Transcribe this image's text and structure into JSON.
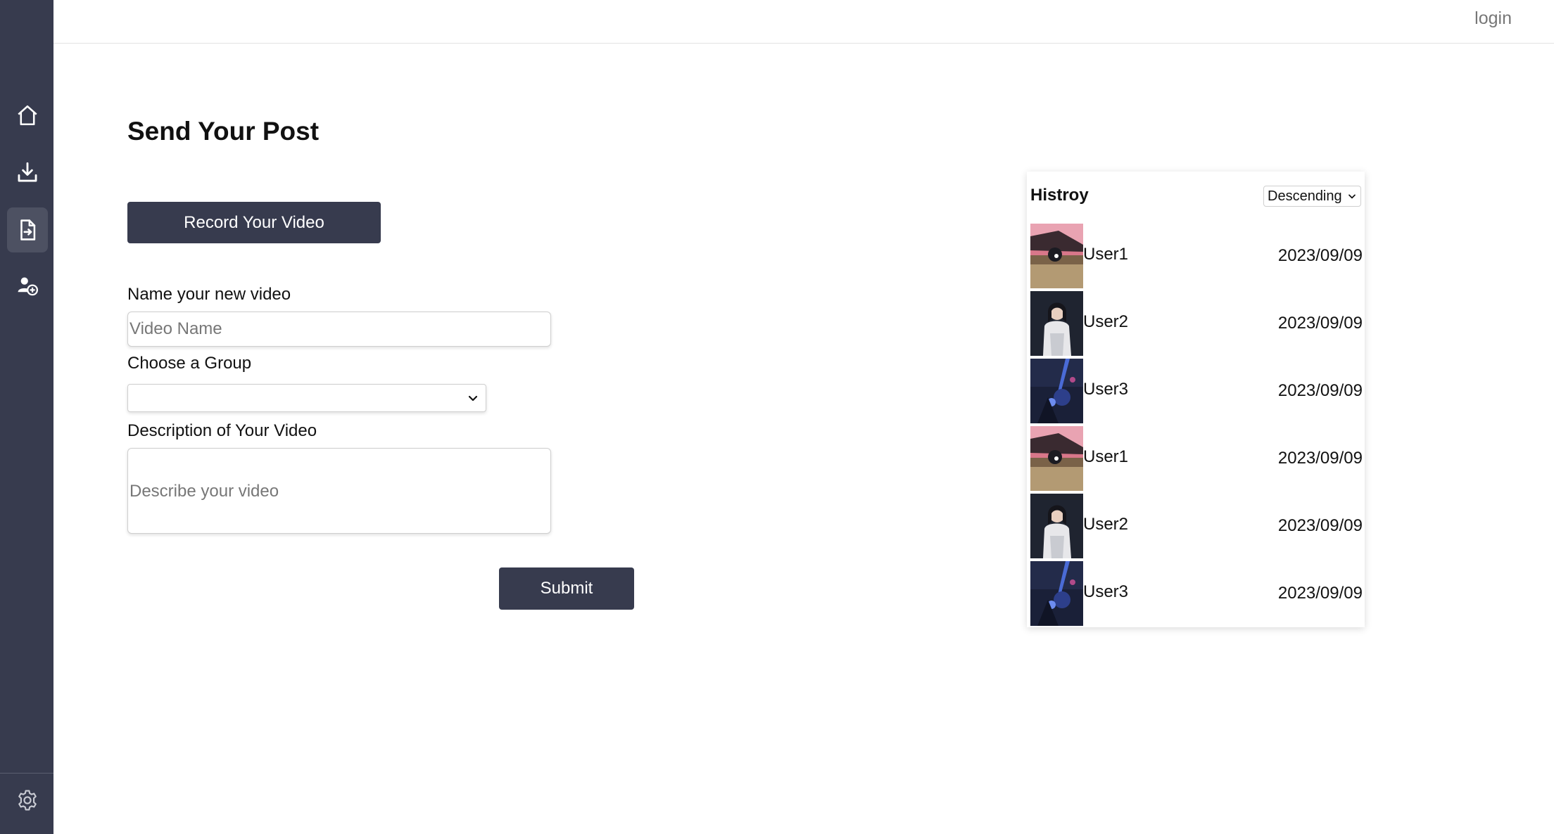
{
  "header": {
    "login_label": "login"
  },
  "sidebar": {
    "items": [
      {
        "icon": "home-icon"
      },
      {
        "icon": "download-icon"
      },
      {
        "icon": "file-export-icon",
        "active": true
      },
      {
        "icon": "add-user-icon"
      }
    ],
    "footer_icon": "gear-icon"
  },
  "main": {
    "title": "Send Your Post",
    "record_button_label": "Record Your Video",
    "name_label": "Name your new video",
    "name_placeholder": "Video Name",
    "group_label": "Choose a Group",
    "group_selected": "",
    "description_label": "Description of Your Video",
    "description_placeholder": "Describe your video",
    "submit_label": "Submit"
  },
  "history": {
    "title": "Histroy",
    "sort_selected": "Descending",
    "items": [
      {
        "user": "User1",
        "date": "2023/09/09",
        "thumb": "pink-scene"
      },
      {
        "user": "User2",
        "date": "2023/09/09",
        "thumb": "white-dress"
      },
      {
        "user": "User3",
        "date": "2023/09/09",
        "thumb": "blue-concert"
      },
      {
        "user": "User1",
        "date": "2023/09/09",
        "thumb": "pink-scene"
      },
      {
        "user": "User2",
        "date": "2023/09/09",
        "thumb": "white-dress"
      },
      {
        "user": "User3",
        "date": "2023/09/09",
        "thumb": "blue-concert"
      }
    ]
  },
  "colors": {
    "sidebar_bg": "#373b4e",
    "button_bg": "#373b4e",
    "button_text": "#ffffff"
  }
}
